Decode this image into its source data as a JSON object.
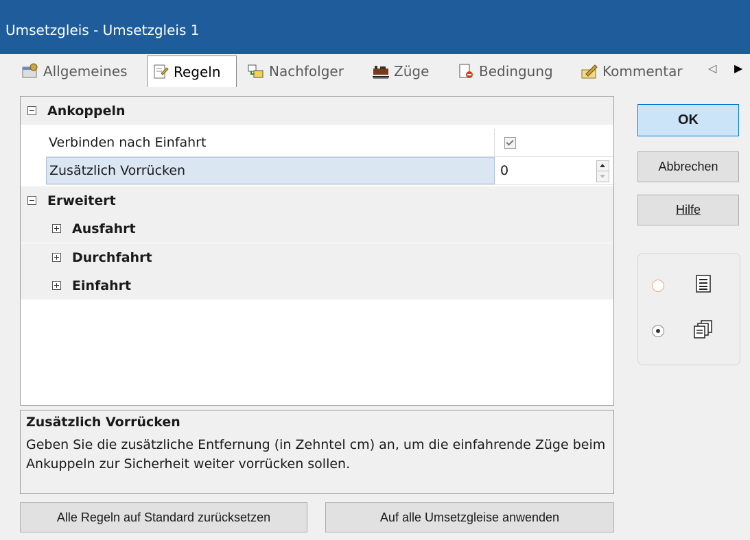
{
  "window": {
    "title": "Umsetzgleis - Umsetzgleis 1"
  },
  "tabs": [
    {
      "label": "Allgemeines",
      "icon": "settings-window-icon",
      "active": false
    },
    {
      "label": "Regeln",
      "icon": "rules-document-icon",
      "active": true
    },
    {
      "label": "Nachfolger",
      "icon": "successor-blocks-icon",
      "active": false
    },
    {
      "label": "Züge",
      "icon": "trains-icon",
      "active": false
    },
    {
      "label": "Bedingung",
      "icon": "condition-document-icon",
      "active": false
    },
    {
      "label": "Kommentar",
      "icon": "comment-pencil-icon",
      "active": false
    }
  ],
  "tab_scroll": {
    "left": "◁",
    "right": "▶"
  },
  "grid": {
    "categories": [
      {
        "label": "Ankoppeln",
        "expanded": true
      },
      {
        "label": "Erweitert",
        "expanded": true
      }
    ],
    "properties": [
      {
        "name": "Verbinden nach Einfahrt",
        "value": "checked"
      },
      {
        "name": "Zusätzlich Vorrücken",
        "value": "0"
      }
    ],
    "subcategories": [
      {
        "label": "Ausfahrt"
      },
      {
        "label": "Durchfahrt"
      },
      {
        "label": "Einfahrt"
      }
    ]
  },
  "help": {
    "title": "Zusätzlich Vorrücken",
    "body": "Geben Sie die zusätzliche Entfernung (in Zehntel cm) an, um die einfahrende Züge beim Ankuppeln zur Sicherheit weiter vorrücken sollen."
  },
  "buttons": {
    "ok": "OK",
    "cancel": "Abbrechen",
    "help": "Hilfe",
    "reset": "Alle Regeln auf Standard zurücksetzen",
    "apply_all": "Auf alle Umsetzgleise anwenden"
  },
  "view_mode": {
    "options": [
      "list-view-icon",
      "grouped-view-icon"
    ],
    "selected": "grouped-view-icon"
  },
  "colors": {
    "titlebar": "#1e5c9c",
    "selection": "#dbe6f3",
    "default_button": "#cce4f7"
  }
}
